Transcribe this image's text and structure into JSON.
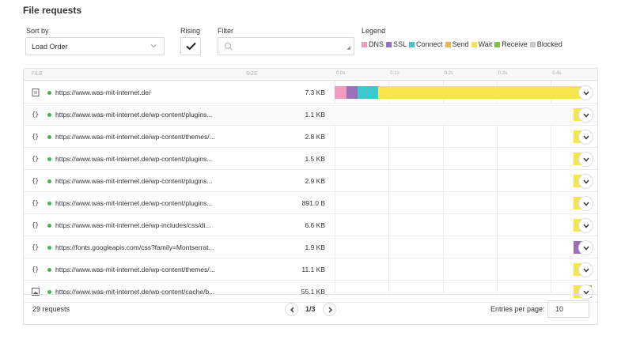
{
  "title": "File requests",
  "controls": {
    "sort_label": "Sort by",
    "sort_value": "Load Order",
    "rising_label": "Rising",
    "rising_checked": true,
    "filter_label": "Filter",
    "filter_value": ""
  },
  "legend": {
    "label": "Legend",
    "items": [
      {
        "name": "DNS",
        "color": "#f49ac1"
      },
      {
        "name": "SSL",
        "color": "#9c6fba"
      },
      {
        "name": "Connect",
        "color": "#3fc7cf"
      },
      {
        "name": "Send",
        "color": "#f4b24a"
      },
      {
        "name": "Wait",
        "color": "#f8e44c"
      },
      {
        "name": "Receive",
        "color": "#7cc243"
      },
      {
        "name": "Blocked",
        "color": "#c8c8c8"
      }
    ]
  },
  "table": {
    "col_file": "FILE",
    "col_size": "SIZE",
    "ticks": [
      "0.0s",
      "0.1s",
      "0.2s",
      "0.3s",
      "0.4s"
    ],
    "rows": [
      {
        "icon": "document-icon",
        "url": "https://www.was-mit-internet.de/",
        "size": "7.3 KB",
        "timing": [
          {
            "phase": "DNS",
            "start": 0.0,
            "dur": 0.022
          },
          {
            "phase": "SSL",
            "start": 0.022,
            "dur": 0.02
          },
          {
            "phase": "Connect",
            "start": 0.042,
            "dur": 0.038
          },
          {
            "phase": "Wait",
            "start": 0.08,
            "dur": 0.38
          }
        ]
      },
      {
        "icon": "code-icon",
        "url": "https://www.was-mit-internet.de/wp-content/plugins...",
        "size": "1.1 KB",
        "timing": [
          {
            "phase": "Wait",
            "start": 0.442,
            "dur": 0.022
          }
        ]
      },
      {
        "icon": "code-icon",
        "url": "https://www.was-mit-internet.de/wp-content/themes/...",
        "size": "2.8 KB",
        "timing": [
          {
            "phase": "Wait",
            "start": 0.442,
            "dur": 0.022
          }
        ]
      },
      {
        "icon": "code-icon",
        "url": "https://www.was-mit-internet.de/wp-content/plugins...",
        "size": "1.5 KB",
        "timing": [
          {
            "phase": "Wait",
            "start": 0.442,
            "dur": 0.022
          }
        ]
      },
      {
        "icon": "code-icon",
        "url": "https://www.was-mit-internet.de/wp-content/plugins...",
        "size": "2.9 KB",
        "timing": [
          {
            "phase": "Wait",
            "start": 0.442,
            "dur": 0.022
          }
        ]
      },
      {
        "icon": "code-icon",
        "url": "https://www.was-mit-internet.de/wp-content/plugins...",
        "size": "891.0 B",
        "timing": [
          {
            "phase": "Wait",
            "start": 0.442,
            "dur": 0.022
          }
        ]
      },
      {
        "icon": "code-icon",
        "url": "https://www.was-mit-internet.de/wp-includes/css/di...",
        "size": "6.6 KB",
        "timing": [
          {
            "phase": "Wait",
            "start": 0.442,
            "dur": 0.022
          }
        ]
      },
      {
        "icon": "code-icon",
        "url": "https://fonts.googleapis.com/css?family=Montserrat...",
        "size": "1.9 KB",
        "timing": [
          {
            "phase": "SSL",
            "start": 0.442,
            "dur": 0.014
          },
          {
            "phase": "Connect",
            "start": 0.456,
            "dur": 0.008
          },
          {
            "phase": "Wait",
            "start": 0.464,
            "dur": 0.006
          }
        ]
      },
      {
        "icon": "code-icon",
        "url": "https://www.was-mit-internet.de/wp-content/themes/...",
        "size": "11.1 KB",
        "timing": [
          {
            "phase": "Wait",
            "start": 0.442,
            "dur": 0.022
          }
        ]
      },
      {
        "icon": "image-icon",
        "url": "https://www.was-mit-internet.de/wp-content/cache/b...",
        "size": "55.1 KB",
        "timing": [
          {
            "phase": "Wait",
            "start": 0.442,
            "dur": 0.022
          },
          {
            "phase": "Receive",
            "start": 0.464,
            "dur": 0.012
          }
        ]
      }
    ]
  },
  "footer": {
    "requests": "29 requests",
    "page": "1/3",
    "entries_label": "Entries per page:",
    "entries_value": "10"
  }
}
